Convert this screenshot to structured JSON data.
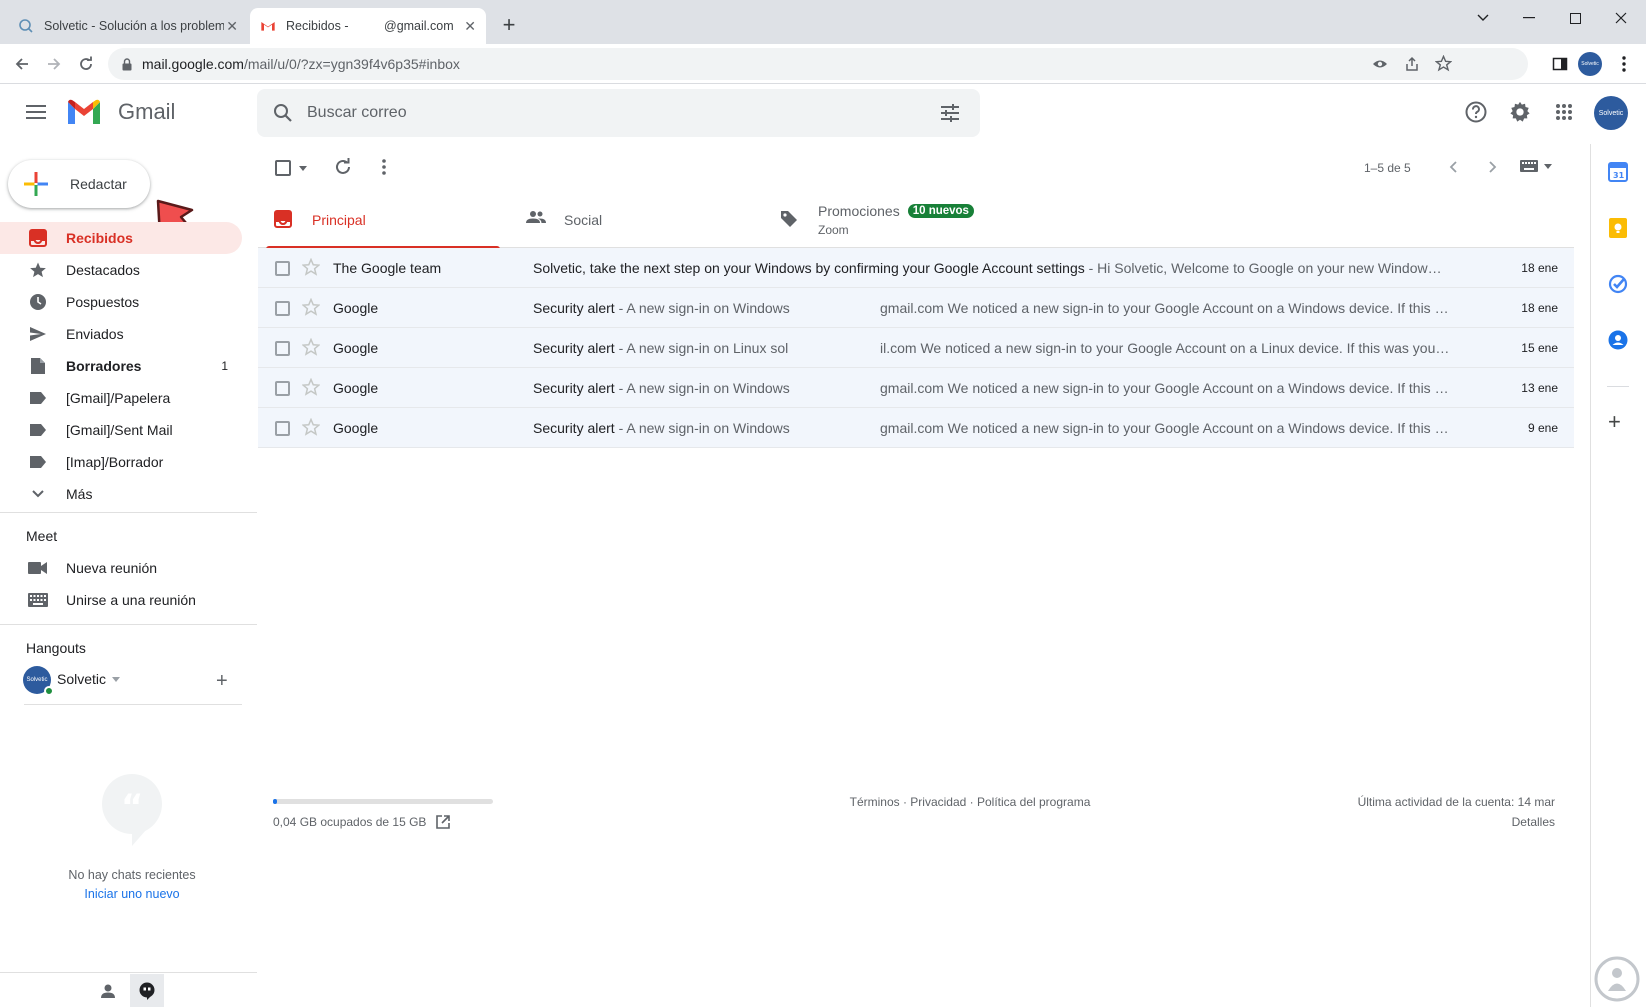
{
  "browser": {
    "tabs": [
      {
        "title": "Solvetic - Solución a los problemas",
        "active": false
      },
      {
        "title": "Recibidos -",
        "title_suffix": "@gmail.com",
        "active": true
      }
    ],
    "url_host": "mail.google.com",
    "url_path": "/mail/u/0/?zx=ygn39f4v6p35#inbox",
    "avatar_text": "Solvetic"
  },
  "header": {
    "app_name": "Gmail",
    "search_placeholder": "Buscar correo"
  },
  "sidebar": {
    "compose_label": "Redactar",
    "items": [
      {
        "label": "Recibidos",
        "icon": "inbox-icon",
        "active": true,
        "count": ""
      },
      {
        "label": "Destacados",
        "icon": "star-icon",
        "count": ""
      },
      {
        "label": "Pospuestos",
        "icon": "clock-icon",
        "count": ""
      },
      {
        "label": "Enviados",
        "icon": "send-icon",
        "count": ""
      },
      {
        "label": "Borradores",
        "icon": "draft-icon",
        "count": "1",
        "bold": true
      },
      {
        "label": "[Gmail]/Papelera",
        "icon": "label-icon",
        "count": ""
      },
      {
        "label": "[Gmail]/Sent Mail",
        "icon": "label-icon",
        "count": ""
      },
      {
        "label": "[Imap]/Borrador",
        "icon": "label-icon",
        "count": ""
      },
      {
        "label": "Más",
        "icon": "chevron-down-icon",
        "count": ""
      }
    ],
    "meet": {
      "title": "Meet",
      "items": [
        {
          "label": "Nueva reunión",
          "icon": "video-icon"
        },
        {
          "label": "Unirse a una reunión",
          "icon": "keyboard-icon"
        }
      ]
    },
    "hangouts": {
      "title": "Hangouts",
      "user": "Solvetic",
      "no_chats": "No hay chats recientes",
      "start_new": "Iniciar uno nuevo"
    }
  },
  "toolbar": {
    "pagination": "1–5 de 5"
  },
  "categories": [
    {
      "label": "Principal",
      "icon": "inbox-icon",
      "active": true
    },
    {
      "label": "Social",
      "icon": "people-icon"
    },
    {
      "label": "Promociones",
      "icon": "tag-icon",
      "badge": "10 nuevos",
      "sub": "Zoom"
    }
  ],
  "emails": [
    {
      "sender": "The Google team",
      "subject": "Solvetic, take the next step on your Windows by confirming your Google Account settings",
      "snippet": " - Hi Solvetic, Welcome to Google on your new Window…",
      "date": "18 ene",
      "masked": false
    },
    {
      "sender": "Google",
      "subject": "Security alert",
      "snippet_a": " - A new sign-in on Windows",
      "snippet_b": "gmail.com We noticed a new sign-in to your Google Account on a Windows device. If this …",
      "date": "18 ene",
      "masked": true
    },
    {
      "sender": "Google",
      "subject": "Security alert",
      "snippet_a": " - A new sign-in on Linux sol",
      "snippet_b": "il.com We noticed a new sign-in to your Google Account on a Linux device. If this was you…",
      "date": "15 ene",
      "masked": true
    },
    {
      "sender": "Google",
      "subject": "Security alert",
      "snippet_a": " - A new sign-in on Windows",
      "snippet_b": "gmail.com We noticed a new sign-in to your Google Account on a Windows device. If this …",
      "date": "13 ene",
      "masked": true
    },
    {
      "sender": "Google",
      "subject": "Security alert",
      "snippet_a": " - A new sign-in on Windows",
      "snippet_b": "gmail.com We noticed a new sign-in to your Google Account on a Windows device. If this …",
      "date": "9 ene",
      "masked": true
    }
  ],
  "footer": {
    "storage": "0,04 GB ocupados de 15 GB",
    "storage_fraction": 0.003,
    "links": "Términos · Privacidad · Política del programa",
    "last_activity": "Última actividad de la cuenta: 14 mar",
    "details": "Detalles"
  },
  "colors": {
    "accent_red": "#d93025",
    "badge_green": "#188038",
    "active_bg": "#fce8e6",
    "row_bg": "#f2f6fc"
  }
}
